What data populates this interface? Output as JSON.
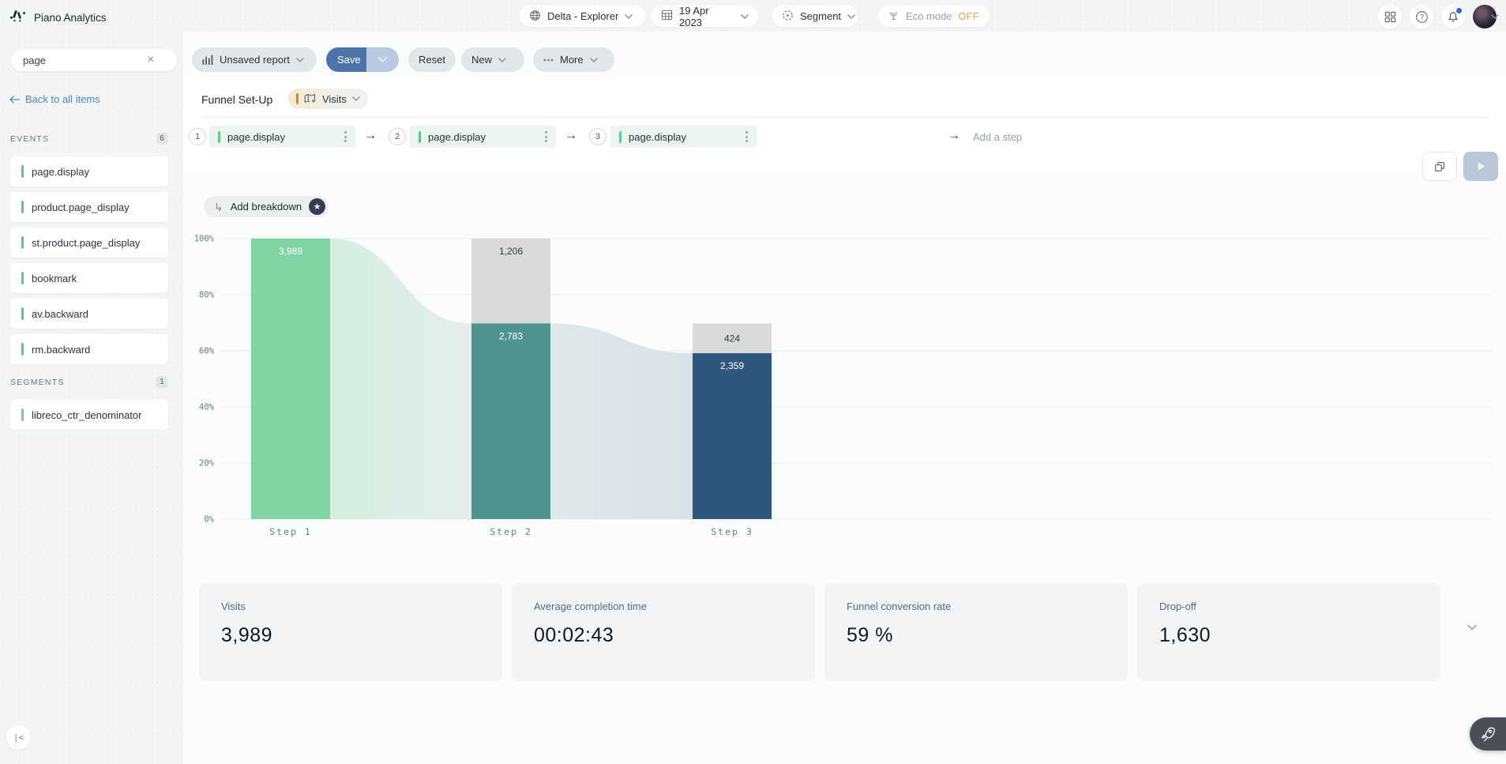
{
  "app": {
    "title": "Piano Analytics"
  },
  "topbar": {
    "site_picker": {
      "label": "Delta - Explorer"
    },
    "date_picker": {
      "label": "19 Apr 2023"
    },
    "segment_picker": {
      "label": "Segment"
    },
    "eco_mode": {
      "label": "Eco mode",
      "state": "OFF"
    }
  },
  "sidebar": {
    "search": {
      "value": "page"
    },
    "back_link": "Back to all items",
    "events": {
      "title": "EVENTS",
      "count": "6",
      "items": [
        "page.display",
        "product.page_display",
        "st.product.page_display",
        "bookmark",
        "av.backward",
        "rm.backward"
      ]
    },
    "segments": {
      "title": "SEGMENTS",
      "count": "1",
      "items": [
        "libreco_ctr_denominator"
      ]
    },
    "collapse_icon": "|<"
  },
  "toolbar": {
    "report_name": "Unsaved report",
    "save_label": "Save",
    "reset_label": "Reset",
    "new_label": "New",
    "more_label": "More"
  },
  "funnel_setup": {
    "title": "Funnel Set-Up",
    "metric": "Visits",
    "steps": [
      {
        "num": "1",
        "label": "page.display"
      },
      {
        "num": "2",
        "label": "page.display"
      },
      {
        "num": "3",
        "label": "page.display"
      }
    ],
    "arrow": "→",
    "add_step": "Add a step"
  },
  "breakdown": {
    "label": "Add breakdown",
    "star": "★",
    "hook": "↳"
  },
  "chart_data": {
    "type": "funnel",
    "title": "",
    "total": 3989,
    "categories": [
      "Step 1",
      "Step 2",
      "Step 3"
    ],
    "series": [
      {
        "name": "converted",
        "values": [
          3989,
          2783,
          2359
        ]
      },
      {
        "name": "dropped",
        "values": [
          0,
          1206,
          424
        ]
      }
    ],
    "steps": [
      {
        "converted": 3989,
        "dropped": 0,
        "converted_label": "3,989",
        "dropped_label": ""
      },
      {
        "converted": 2783,
        "dropped": 1206,
        "converted_label": "2,783",
        "dropped_label": "1,206"
      },
      {
        "converted": 2359,
        "dropped": 424,
        "converted_label": "2,359",
        "dropped_label": "424"
      }
    ],
    "tick_labels": [
      "0%",
      "20%",
      "40%",
      "60%",
      "80%",
      "100%"
    ],
    "ylim": [
      0,
      100
    ],
    "grid": true,
    "bar_colors": [
      "#80d3a2",
      "#4f948e",
      "#2f577e"
    ],
    "dropped_color": "#d9dbd8",
    "area_gradients": [
      [
        "#d5efe0",
        "#e3edec"
      ],
      [
        "#e0e9e9",
        "#d8e2ea"
      ]
    ]
  },
  "cards": [
    {
      "label": "Visits",
      "value": "3,989"
    },
    {
      "label": "Average completion time",
      "value": "00:02:43"
    },
    {
      "label": "Funnel conversion rate",
      "value": "59 %"
    },
    {
      "label": "Drop-off",
      "value": "1,630"
    }
  ],
  "colors": {
    "event_accent": "#62c78f",
    "segment_accent": "#85b6e3",
    "save_blue": "#4e73a8",
    "eco_off": "#e9a23b",
    "link_blue": "#4b87c6"
  }
}
